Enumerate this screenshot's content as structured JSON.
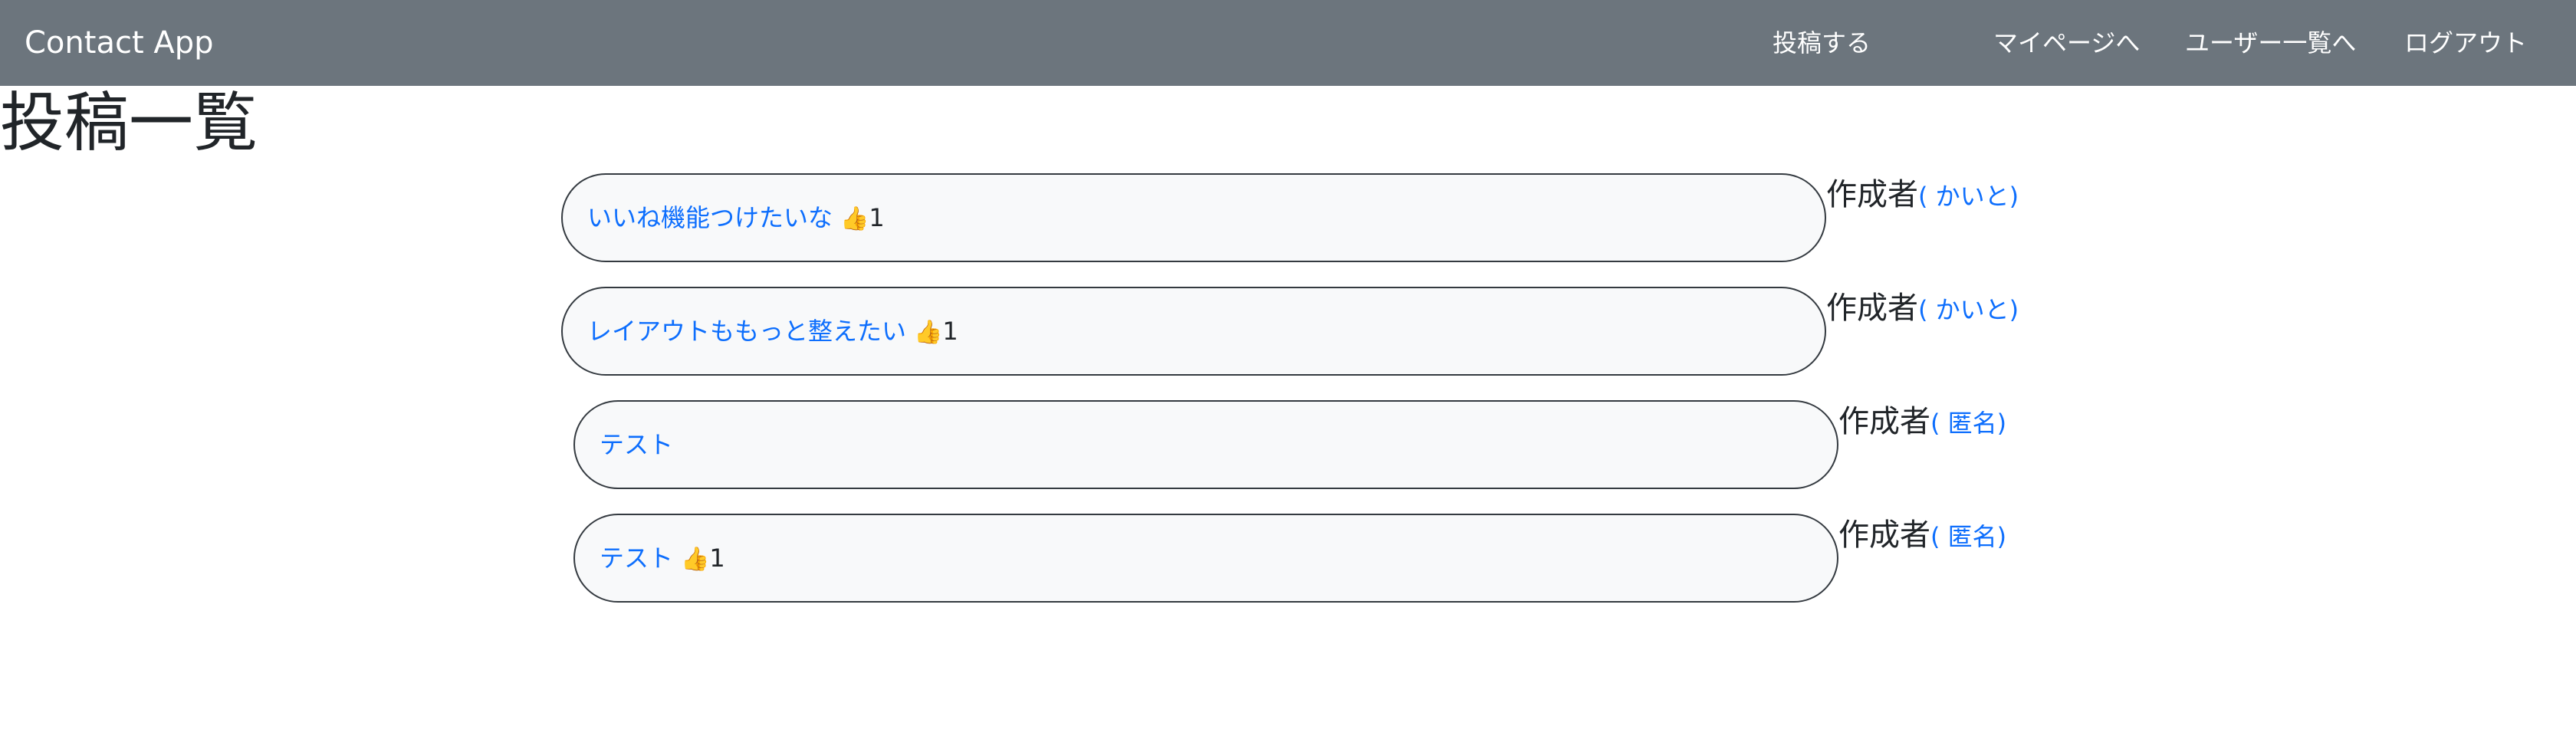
{
  "navbar": {
    "brand": "Contact App",
    "links": [
      "投稿する",
      "マイページへ",
      "ユーザー一覧へ",
      "ログアウト"
    ]
  },
  "page": {
    "title": "投稿一覧"
  },
  "posts": [
    {
      "title": "いいね機能つけたいな",
      "likes": "1",
      "author_label": "作成者",
      "author": "( かいと)"
    },
    {
      "title": "レイアウトももっと整えたい",
      "likes": "1",
      "author_label": "作成者",
      "author": "( かいと)"
    },
    {
      "title": "テスト",
      "likes": "",
      "author_label": "作成者",
      "author": "( 匿名)"
    },
    {
      "title": "テスト",
      "likes": "1",
      "author_label": "作成者",
      "author": "( 匿名)"
    }
  ],
  "icons": {
    "like": "thumbs-up-icon"
  },
  "colors": {
    "navbar_bg": "#6c757d",
    "link": "#0d6efd",
    "post_bg": "#f8f9fa",
    "post_border": "#343a40"
  }
}
